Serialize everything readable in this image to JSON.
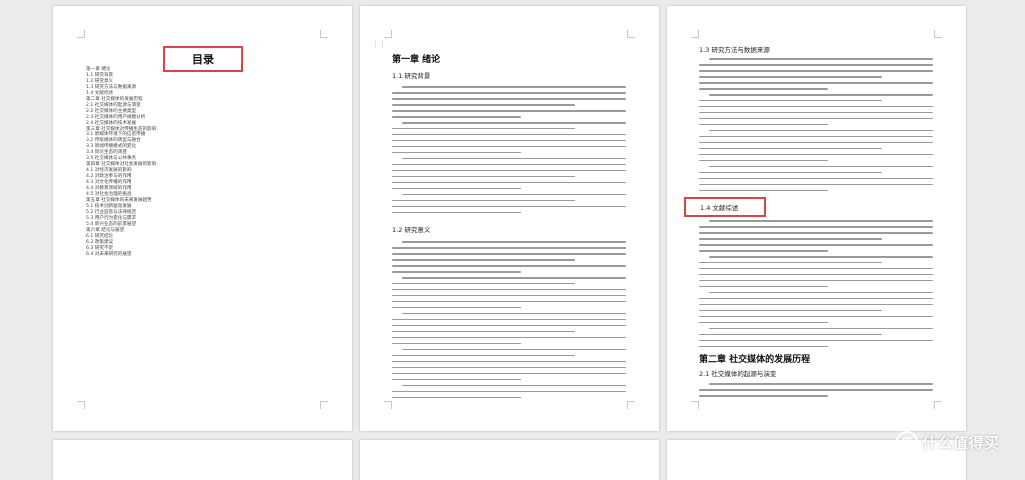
{
  "page1": {
    "toc_title": "目录",
    "toc_items": [
      "第一章 绪论",
      "1.1 研究背景",
      "1.2 研究意义",
      "1.3 研究方法与数据来源",
      "1.4 文献综述",
      "第二章 社交媒体的发展历程",
      "2.1 社交媒体的起源与演变",
      "2.2 社交媒体的主要类型",
      "2.3 社交媒体的用户规模分析",
      "2.4 社交媒体的技术发展",
      "第三章 社交媒体对传播生态的影响",
      "3.1 新媒体环境下的信息传播",
      "3.2 传统媒体的转型与融合",
      "3.3 新闻传播模式的变化",
      "3.4 舆论生态的演变",
      "3.5 社交媒体与公共事务",
      "第四章 社交媒体对社会发展的影响",
      "4.1 对经济发展的影响",
      "4.2 对政治参与的作用",
      "4.3 对文化传播的作用",
      "4.4 对教育领域的作用",
      "4.5 对社会治理的挑战",
      "第五章 社交媒体的未来发展趋势",
      "5.1 技术创新驱动发展",
      "5.2 行业监管与法律规范",
      "5.3 用户行为变化与需求",
      "5.4 新兴业态的前景展望",
      "第六章 结论与展望",
      "6.1 研究结论",
      "6.2 政策建议",
      "6.3 研究不足",
      "6.4 对未来研究的展望"
    ]
  },
  "page2": {
    "chapter_title": "第一章 绪论",
    "section_1": "1.1 研究背景",
    "section_2": "1.2 研究意义"
  },
  "page3": {
    "section_top": "1.3 研究方法与数据来源",
    "highlight_section": "1.4 文献综述",
    "chapter_title": "第二章 社交媒体的发展历程",
    "section_bottom": "2.1 社交媒体的起源与演变"
  },
  "watermark": {
    "icon": "值",
    "text": "什么值得买"
  },
  "colors": {
    "highlight_border": "#d94545",
    "background": "#ebebeb",
    "page": "#ffffff"
  }
}
